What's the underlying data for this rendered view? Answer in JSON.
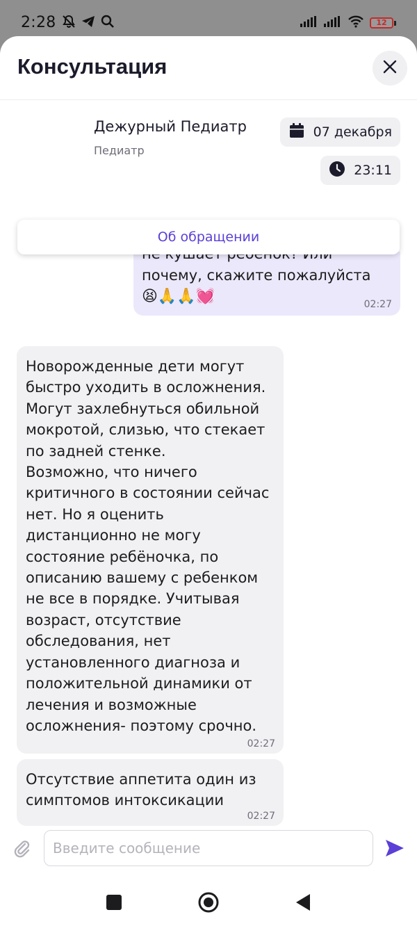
{
  "status": {
    "time": "2:28",
    "battery": "12",
    "icons": [
      "dnd-off-icon",
      "telegram-icon",
      "search-icon",
      "signal-icon",
      "signal-icon",
      "wifi-icon",
      "battery-icon"
    ]
  },
  "header": {
    "title": "Консультация",
    "close_icon": "close-icon"
  },
  "doctor": {
    "name": "Дежурный Педиатр",
    "role": "Педиатр"
  },
  "meta": {
    "date": "07 декабря",
    "time": "23:11"
  },
  "about_button": "Об обращении",
  "messages": [
    {
      "direction": "outgoing",
      "text": "не кушает ребенок? Или почему, скажите пожалуйста",
      "emoji": "😫🙏🙏💓",
      "time": "02:27"
    },
    {
      "direction": "incoming",
      "text": "Новорожденные дети могут быстро уходить в осложнения. Могут захлебнуться обильной мокротой, слизью, что стекает по задней стенке.\nВозможно, что ничего критичного в состоянии сейчас нет. Но я оценить дистанционно не могу состояние ребёночка, по описанию вашему с ребенком не все в порядке. Учитывая возраст, отсутствие обследования, нет установленного диагноза и положительной динамики от лечения и возможные осложнения- поэтому срочно.",
      "time": "02:27"
    },
    {
      "direction": "incoming",
      "text": "Отсутствие аппетита один из симптомов интоксикации",
      "time": "02:27"
    }
  ],
  "composer": {
    "placeholder": "Введите сообщение",
    "value": ""
  },
  "colors": {
    "accent": "#5b3fd6",
    "outgoing_bubble": "#ece8fb",
    "incoming_bubble": "#f1f1f4",
    "overlay": "#8f8f8f"
  }
}
